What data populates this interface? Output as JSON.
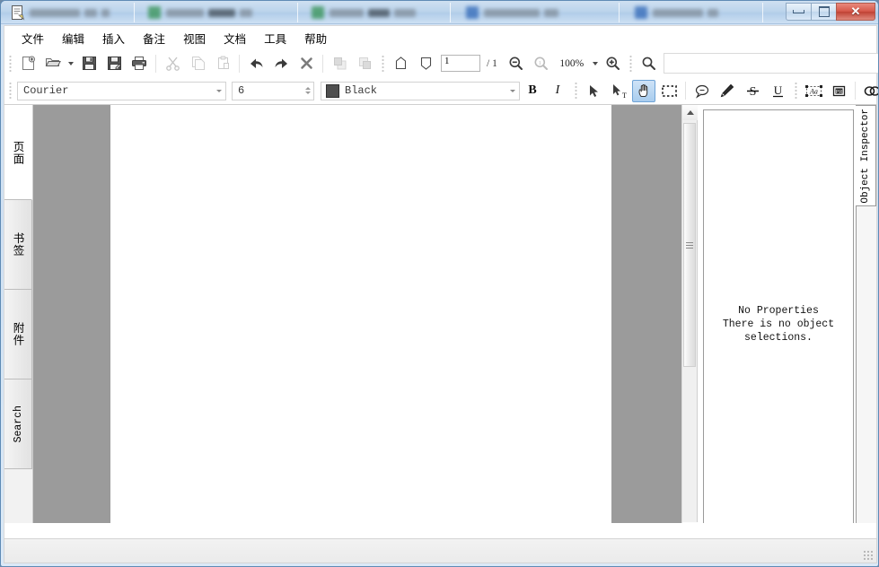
{
  "window": {
    "title": "",
    "controls": {
      "minimize": "Minimize",
      "maximize": "Restore",
      "close": "Close"
    }
  },
  "menubar": {
    "items": [
      {
        "label": "文件"
      },
      {
        "label": "编辑"
      },
      {
        "label": "插入"
      },
      {
        "label": "备注"
      },
      {
        "label": "视图"
      },
      {
        "label": "文档"
      },
      {
        "label": "工具"
      },
      {
        "label": "帮助"
      }
    ]
  },
  "toolbar_main": {
    "buttons": [
      {
        "name": "new-document-button",
        "icon": "new-file-icon",
        "label": "New"
      },
      {
        "name": "open-document-button",
        "icon": "open-folder-icon",
        "label": "Open"
      },
      {
        "name": "save-button",
        "icon": "floppy-disk-icon",
        "label": "Save"
      },
      {
        "name": "save-as-button",
        "icon": "floppy-disk-pen-icon",
        "label": "Save As"
      },
      {
        "name": "print-button",
        "icon": "printer-icon",
        "label": "Print"
      },
      {
        "name": "cut-button",
        "icon": "scissors-icon",
        "label": "Cut"
      },
      {
        "name": "copy-button",
        "icon": "copy-pages-icon",
        "label": "Copy"
      },
      {
        "name": "paste-button",
        "icon": "clipboard-paste-icon",
        "label": "Paste"
      },
      {
        "name": "undo-button",
        "icon": "undo-arrow-icon",
        "label": "Undo"
      },
      {
        "name": "redo-button",
        "icon": "redo-arrow-icon",
        "label": "Redo"
      },
      {
        "name": "delete-button",
        "icon": "cross-delete-icon",
        "label": "Delete"
      },
      {
        "name": "bring-to-front-button",
        "icon": "bring-front-icon",
        "label": "Bring to Front"
      },
      {
        "name": "send-to-back-button",
        "icon": "send-back-icon",
        "label": "Send to Back"
      },
      {
        "name": "first-page-button",
        "icon": "page-up-icon",
        "label": "First Page"
      },
      {
        "name": "last-page-button",
        "icon": "page-down-icon",
        "label": "Last Page"
      }
    ],
    "page_current": "1",
    "page_total": "/ 1",
    "zoom_out": "zoom-out-icon",
    "zoom_actual": "zoom-actual-size-icon",
    "zoom_value": "100%",
    "zoom_in": "zoom-in-icon",
    "search_icon": "search-icon",
    "search_value": "",
    "search_placeholder": ""
  },
  "toolbar_format": {
    "font_name": "Courier",
    "font_size": "6",
    "color_name": "Black",
    "color_hex": "#4f4f4f",
    "bold_label": "B",
    "italic_label": "I",
    "tools": [
      {
        "name": "select-tool",
        "icon": "arrow-pointer-icon",
        "active": false
      },
      {
        "name": "text-select-tool",
        "icon": "text-cursor-arrow-icon",
        "active": false
      },
      {
        "name": "hand-tool",
        "icon": "hand-icon",
        "active": true
      },
      {
        "name": "marquee-select-tool",
        "icon": "dashed-rectangle-icon",
        "active": false
      },
      {
        "name": "comment-tool",
        "icon": "speech-bubble-icon",
        "active": false
      },
      {
        "name": "highlight-tool",
        "icon": "highlighter-pen-icon",
        "active": false
      },
      {
        "name": "strikethrough-tool",
        "icon": "strikethrough-icon",
        "active": false
      },
      {
        "name": "underline-tool",
        "icon": "underline-icon",
        "active": false
      },
      {
        "name": "textbox-tool",
        "icon": "text-box-aa-icon",
        "active": false
      },
      {
        "name": "image-stamp-tool",
        "icon": "image-stamp-icon",
        "active": false
      },
      {
        "name": "link-tool",
        "icon": "chain-link-icon",
        "active": false
      },
      {
        "name": "form-field-tool",
        "icon": "form-field-icon",
        "active": false
      }
    ],
    "overflow_label": "»"
  },
  "left_panel": {
    "tabs": [
      {
        "label": "页面",
        "name": "sidebar-tab-pages",
        "script": "cjk",
        "active": true
      },
      {
        "label": "书签",
        "name": "sidebar-tab-bookmarks",
        "script": "cjk",
        "active": false
      },
      {
        "label": "附件",
        "name": "sidebar-tab-attachments",
        "script": "cjk",
        "active": false
      },
      {
        "label": "Search",
        "name": "sidebar-tab-search",
        "script": "latin",
        "active": false
      }
    ]
  },
  "document": {
    "page_background": "#ffffff",
    "canvas_background": "#9b9b9b"
  },
  "inspector": {
    "tab_label": "Object Inspector",
    "message_line1": "No Properties",
    "message_line2": "There is no object",
    "message_line3": "selections."
  },
  "statusbar": {
    "text": ""
  }
}
